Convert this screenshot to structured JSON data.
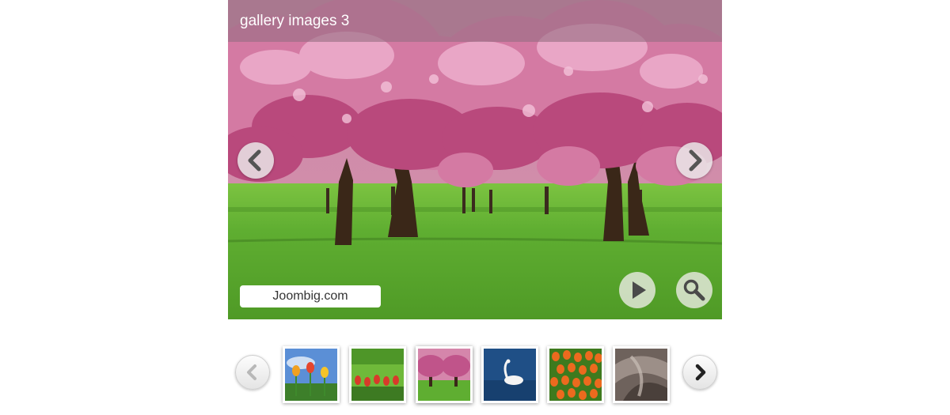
{
  "slideshow": {
    "title": "gallery images 3",
    "caption": "Joombig.com",
    "current_index": 3,
    "prev_icon": "chevron-left-icon",
    "next_icon": "chevron-right-icon",
    "play_icon": "play-icon",
    "zoom_icon": "magnifier-icon"
  },
  "thumbnails": [
    {
      "subject": "tulips-sky"
    },
    {
      "subject": "tulips-lawn"
    },
    {
      "subject": "cherry-trees"
    },
    {
      "subject": "swan"
    },
    {
      "subject": "orange-tulips"
    },
    {
      "subject": "abstract-swirl"
    }
  ],
  "colors": {
    "blossom": "#c8628f",
    "grass": "#5aa62e",
    "title_bar": "#967082"
  }
}
